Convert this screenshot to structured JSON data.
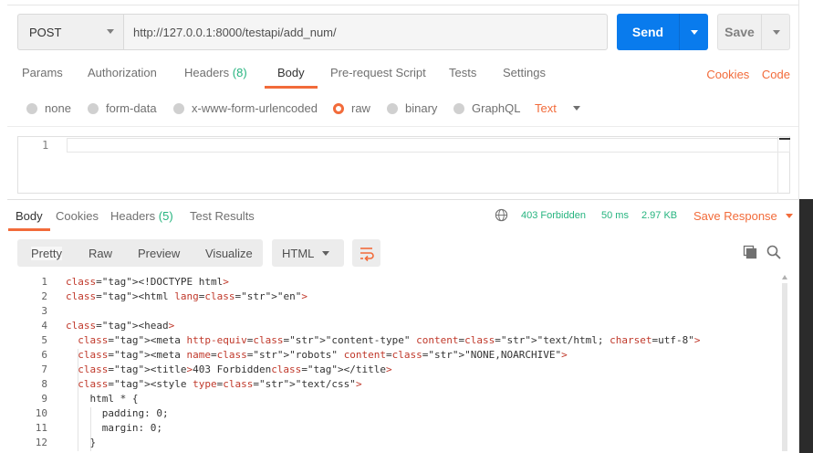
{
  "request": {
    "method": "POST",
    "url": "http://127.0.0.1:8000/testapi/add_num/",
    "send_label": "Send",
    "save_label": "Save"
  },
  "request_tabs": [
    {
      "label": "Params"
    },
    {
      "label": "Authorization"
    },
    {
      "label": "Headers",
      "count": "(8)"
    },
    {
      "label": "Body"
    },
    {
      "label": "Pre-request Script"
    },
    {
      "label": "Tests"
    },
    {
      "label": "Settings"
    }
  ],
  "request_links": {
    "cookies": "Cookies",
    "code": "Code"
  },
  "body_types": [
    "none",
    "form-data",
    "x-www-form-urlencoded",
    "raw",
    "binary",
    "GraphQL"
  ],
  "body_selected": "raw",
  "raw_type": "Text",
  "editor": {
    "line": "1"
  },
  "response_tabs": [
    {
      "label": "Body"
    },
    {
      "label": "Cookies"
    },
    {
      "label": "Headers",
      "count": "(5)"
    },
    {
      "label": "Test Results"
    }
  ],
  "response_status": {
    "status": "403 Forbidden",
    "time": "50 ms",
    "size": "2.97 KB"
  },
  "save_response_label": "Save Response",
  "view_modes": [
    "Pretty",
    "Raw",
    "Preview",
    "Visualize"
  ],
  "format": "HTML",
  "colors": {
    "accent": "#f26b3a",
    "send": "#097bed",
    "success": "#26b47f"
  },
  "code_lines": [
    {
      "n": "1",
      "text": "<!DOCTYPE html>"
    },
    {
      "n": "2",
      "text": "<html lang=\"en\">"
    },
    {
      "n": "3",
      "text": ""
    },
    {
      "n": "4",
      "text": "<head>"
    },
    {
      "n": "5",
      "text": "  <meta http-equiv=\"content-type\" content=\"text/html; charset=utf-8\">"
    },
    {
      "n": "6",
      "text": "  <meta name=\"robots\" content=\"NONE,NOARCHIVE\">"
    },
    {
      "n": "7",
      "text": "  <title>403 Forbidden</title>"
    },
    {
      "n": "8",
      "text": "  <style type=\"text/css\">"
    },
    {
      "n": "9",
      "text": "    html * {"
    },
    {
      "n": "10",
      "text": "      padding: 0;"
    },
    {
      "n": "11",
      "text": "      margin: 0;"
    },
    {
      "n": "12",
      "text": "    }"
    }
  ]
}
